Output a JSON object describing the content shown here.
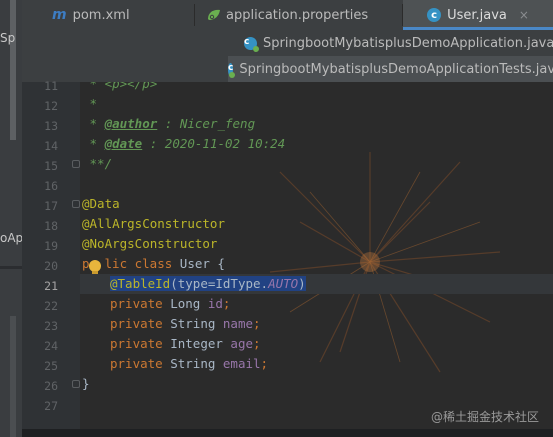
{
  "left_panel": {
    "snippet_1": "Sp",
    "snippet_2": "oAp"
  },
  "tabs_row1": [
    {
      "label": "pom.xml",
      "icon": "maven-m-icon"
    },
    {
      "label": "application.properties",
      "icon": "spring-leaf-icon"
    },
    {
      "label": "User.java",
      "icon": "class-c-icon",
      "active": true,
      "close": "×"
    }
  ],
  "tabs_row2": [
    {
      "label": "SpringbootMybatisplusDemoApplication.java",
      "icon": "spring-class-icon"
    }
  ],
  "tabs_row3": [
    {
      "label": "SpringbootMybatisplusDemoApplicationTests.java",
      "icon": "spring-class-icon"
    }
  ],
  "editor": {
    "line_numbers": [
      "11",
      "12",
      "13",
      "14",
      "15",
      "16",
      "17",
      "18",
      "19",
      "20",
      "21",
      "22",
      "23",
      "24",
      "25",
      "26",
      "27"
    ],
    "current_line": "21",
    "lines": {
      "l11": " * <p></p>",
      "l12": " *",
      "l13_prefix": " * ",
      "l13_tag": "@author",
      "l13_rest": " : Nicer_feng",
      "l14_prefix": " * ",
      "l14_tag": "@date",
      "l14_rest": " : 2020-11-02 10:24",
      "l15": " **/",
      "l17": "@Data",
      "l18": "@AllArgsConstructor",
      "l19": "@NoArgsConstructor",
      "l20_kw1": "p",
      "l20_kw1b": "lic",
      "l20_kw2": " class",
      "l20_name": " User {",
      "l21_ann": "@TableId",
      "l21_a": "(type=IdType.",
      "l21_const": "AUTO",
      "l21_b": ")",
      "l22_kw": "private",
      "l22_type": " Long ",
      "l22_field": "id",
      "l22_end": ";",
      "l23_kw": "private",
      "l23_type": " String ",
      "l23_field": "name",
      "l23_end": ";",
      "l24_kw": "private",
      "l24_type": " Integer ",
      "l24_field": "age",
      "l24_end": ";",
      "l25_kw": "private",
      "l25_type": " String ",
      "l25_field": "email",
      "l25_end": ";",
      "l26": "}"
    }
  },
  "watermark": "@稀土掘金技术社区",
  "colors": {
    "background": "#2b2b2b",
    "comment": "#629755",
    "annotation": "#bbb529",
    "keyword": "#cc7832",
    "field": "#9876aa",
    "selection": "#214283",
    "tab_accent": "#4a88c7"
  }
}
